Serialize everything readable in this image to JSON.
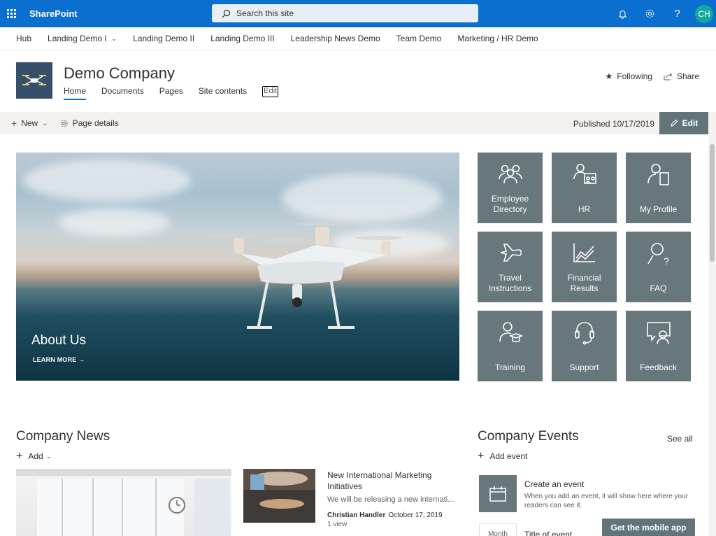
{
  "suite": {
    "brand": "SharePoint",
    "search_placeholder": "Search this site",
    "avatar_initials": "CH",
    "accent": "#0a6fcf"
  },
  "hubnav": {
    "items": [
      {
        "label": "Hub"
      },
      {
        "label": "Landing Demo I",
        "has_dropdown": true
      },
      {
        "label": "Landing Demo II"
      },
      {
        "label": "Landing Demo III"
      },
      {
        "label": "Leadership News Demo"
      },
      {
        "label": "Team Demo"
      },
      {
        "label": "Marketing / HR Demo"
      }
    ]
  },
  "site": {
    "title": "Demo Company",
    "nav": [
      {
        "label": "Home",
        "active": true
      },
      {
        "label": "Documents"
      },
      {
        "label": "Pages"
      },
      {
        "label": "Site contents"
      },
      {
        "label": "Edit"
      }
    ],
    "following": "Following",
    "share": "Share"
  },
  "command": {
    "new": "New",
    "page_details": "Page details",
    "published": "Published 10/17/2019",
    "edit": "Edit"
  },
  "hero": {
    "title": "About Us",
    "link": "LEARN MORE →"
  },
  "quicklinks": {
    "tile_color": "#67777b",
    "tiles": [
      {
        "label": "Employee Directory",
        "icon": "people-icon"
      },
      {
        "label": "HR",
        "icon": "org-icon"
      },
      {
        "label": "My Profile",
        "icon": "profile-icon"
      },
      {
        "label": "Travel Instructions",
        "icon": "airplane-icon"
      },
      {
        "label": "Financial Results",
        "icon": "chart-icon"
      },
      {
        "label": "FAQ",
        "icon": "help-person-icon"
      },
      {
        "label": "Training",
        "icon": "training-icon"
      },
      {
        "label": "Support",
        "icon": "headset-icon"
      },
      {
        "label": "Feedback",
        "icon": "feedback-icon"
      }
    ]
  },
  "news": {
    "title": "Company News",
    "add": "Add",
    "item": {
      "title": "New International Marketing Initiatives",
      "desc": "We will be releasing a new internati...",
      "author": "Christian Handler",
      "date": "October 17, 2019",
      "views": "1 view"
    }
  },
  "events": {
    "title": "Company Events",
    "see_all": "See all",
    "add": "Add event",
    "create_title": "Create an event",
    "create_desc": "When you add an event, it will show here where your readers can see it.",
    "month": "Month",
    "title_of_event": "Title of event",
    "mobile_app": "Get the mobile app"
  }
}
